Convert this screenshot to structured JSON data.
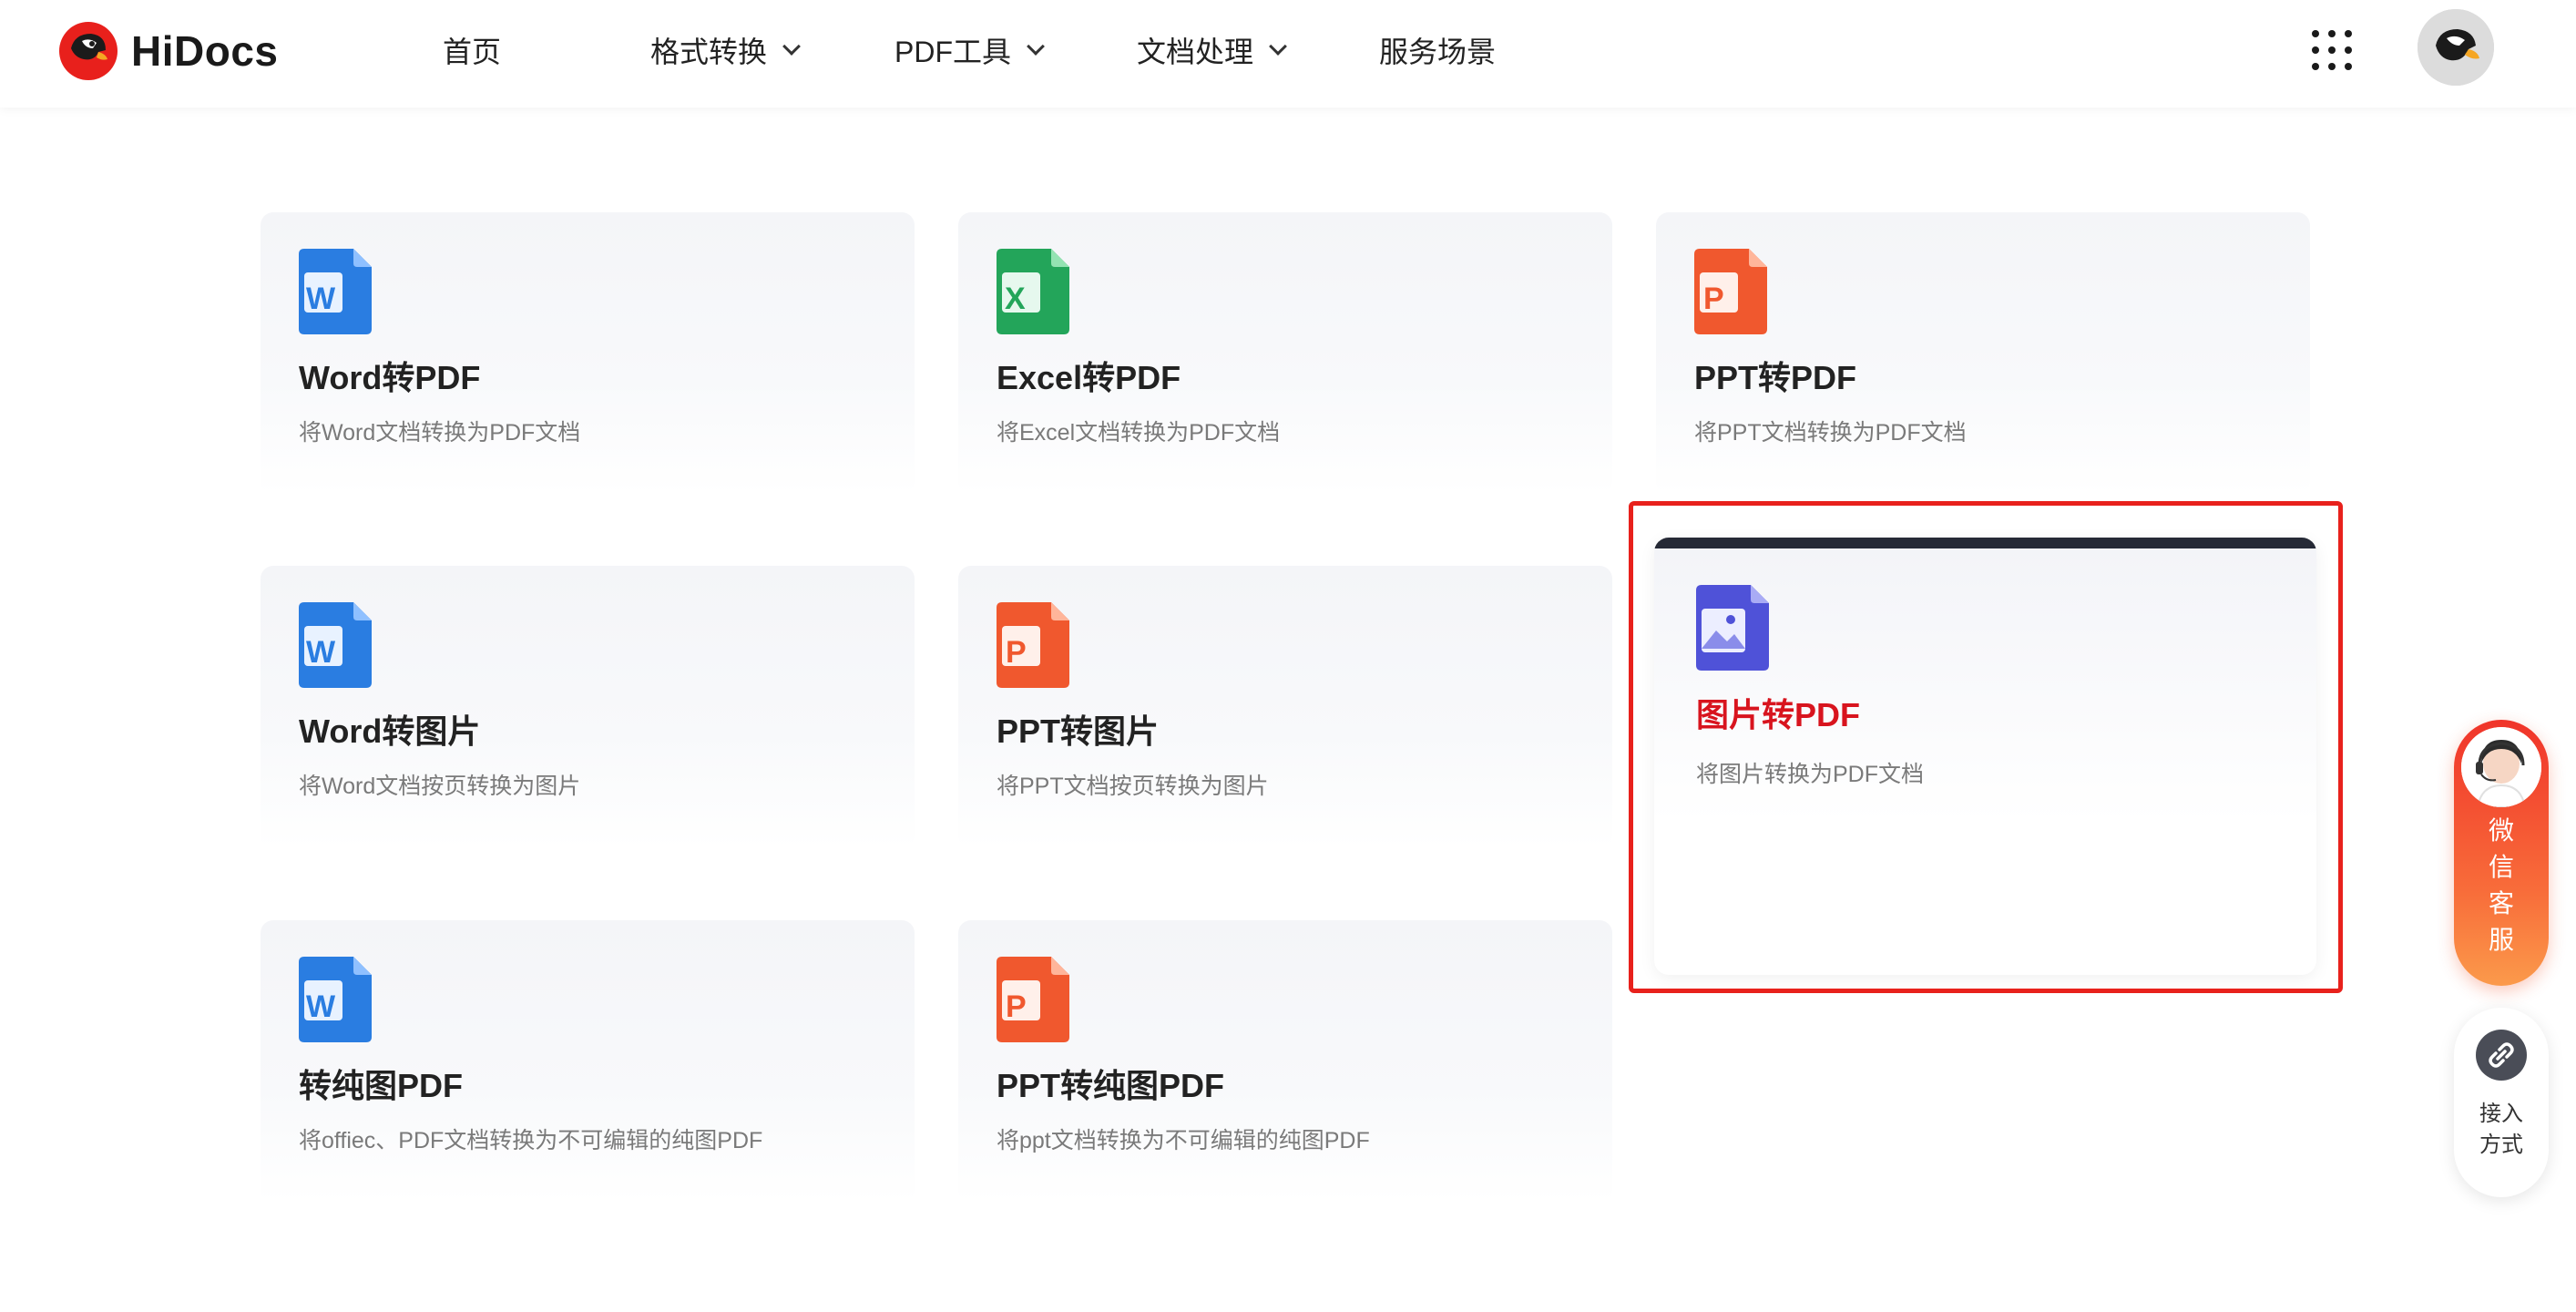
{
  "header": {
    "logo_text": "HiDocs",
    "nav": [
      {
        "label": "首页",
        "has_dropdown": false
      },
      {
        "label": "格式转换",
        "has_dropdown": true
      },
      {
        "label": "PDF工具",
        "has_dropdown": true
      },
      {
        "label": "文档处理",
        "has_dropdown": true
      },
      {
        "label": "服务场景",
        "has_dropdown": false
      }
    ],
    "apps_icon": "grid-dots-icon",
    "avatar_icon": "user-avatar-icon"
  },
  "cards": [
    {
      "title": "Word转PDF",
      "desc": "将Word文档转换为PDF文档",
      "icon": "word-file-icon",
      "icon_letter": "W"
    },
    {
      "title": "Excel转PDF",
      "desc": "将Excel文档转换为PDF文档",
      "icon": "excel-file-icon",
      "icon_letter": "X"
    },
    {
      "title": "PPT转PDF",
      "desc": "将PPT文档转换为PDF文档",
      "icon": "ppt-file-icon",
      "icon_letter": "P"
    },
    {
      "title": "Word转图片",
      "desc": "将Word文档按页转换为图片",
      "icon": "word-file-icon",
      "icon_letter": "W"
    },
    {
      "title": "PPT转图片",
      "desc": "将PPT文档按页转换为图片",
      "icon": "ppt-file-icon",
      "icon_letter": "P"
    },
    {
      "title": "图片转PDF",
      "desc": "将图片转换为PDF文档",
      "icon": "image-file-icon",
      "icon_letter": ""
    },
    {
      "title": "转纯图PDF",
      "desc": "将offiec、PDF文档转换为不可编辑的纯图PDF",
      "icon": "word-file-icon",
      "icon_letter": "W"
    },
    {
      "title": "PPT转纯图PDF",
      "desc": "将ppt文档转换为不可编辑的纯图PDF",
      "icon": "ppt-file-icon",
      "icon_letter": "P"
    }
  ],
  "side": {
    "wechat_label": "微信客服",
    "access_label": "接入方式"
  },
  "colors": {
    "word": "#2a7de1",
    "excel": "#23a55a",
    "ppt": "#f0582e",
    "image": "#4f52d8",
    "active_title": "#d8141e",
    "highlight": "#e8211c"
  }
}
